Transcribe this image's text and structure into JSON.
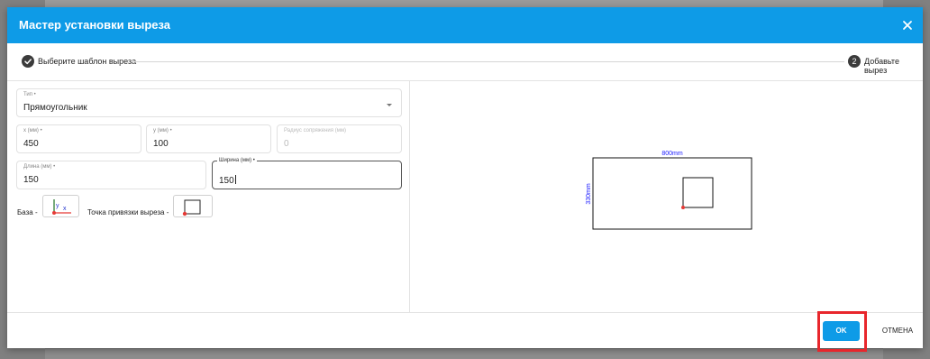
{
  "dialog": {
    "title": "Мастер установки выреза",
    "close_icon": "close-icon"
  },
  "stepper": {
    "step1": {
      "label": "Выберите шаблон выреза",
      "icon": "check-icon"
    },
    "step2": {
      "number": "2",
      "label": "Добавьте вырез"
    }
  },
  "form": {
    "type": {
      "label": "Тип",
      "value": "Прямоугольник"
    },
    "x": {
      "label": "x (мм)",
      "value": "450"
    },
    "y": {
      "label": "y (мм)",
      "value": "100"
    },
    "radius": {
      "label": "Радиус сопряжения (мм)",
      "value": "0"
    },
    "length": {
      "label": "Длина (мм)",
      "value": "150"
    },
    "width": {
      "label": "Ширина (мм)",
      "value": "150"
    },
    "base_label": "База -",
    "anchor_label": "Точка привязки выреза -",
    "axis_x": "x",
    "axis_y": "y"
  },
  "preview": {
    "width_label": "800mm",
    "height_label": "330mm"
  },
  "footer": {
    "ok_label": "OK",
    "cancel_label": "ОТМЕНА"
  },
  "colors": {
    "accent": "#0e9be7",
    "highlight": "#e8262c",
    "anchor_point": "#e53935",
    "axis_y": "#2e7d32",
    "dimension_text": "#1a1aff"
  }
}
